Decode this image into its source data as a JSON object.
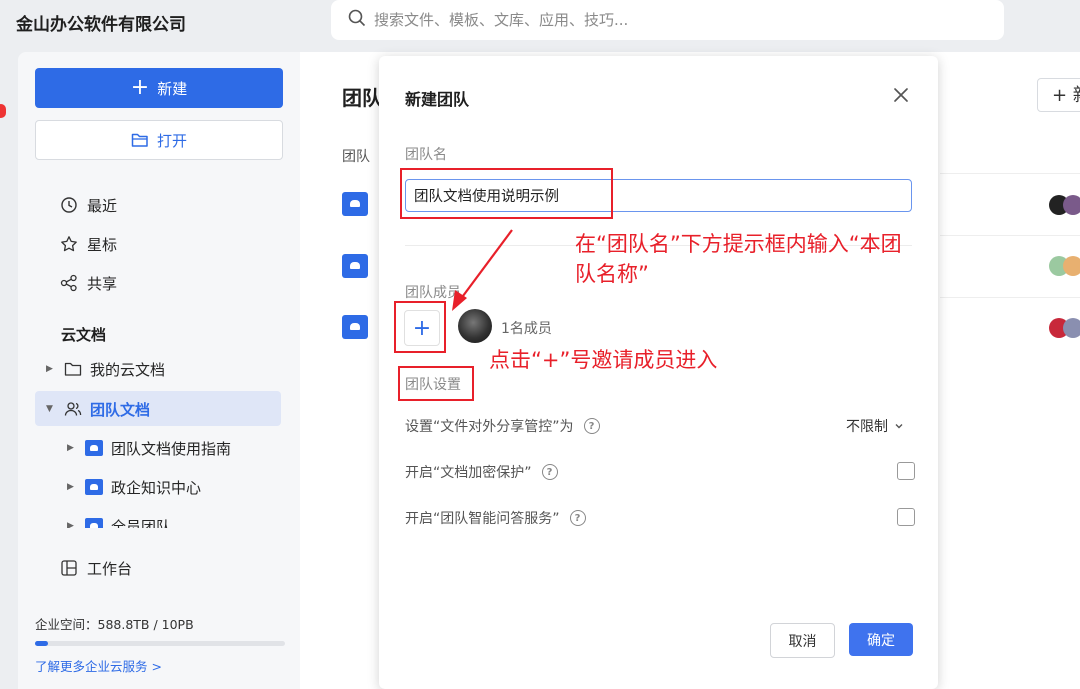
{
  "app": {
    "company": "金山办公软件有限公司",
    "search_placeholder": "搜索文件、模板、文库、应用、技巧..."
  },
  "sidebar": {
    "new_label": "新建",
    "open_label": "打开",
    "nav": [
      {
        "label": "最近",
        "icon": "clock-icon"
      },
      {
        "label": "星标",
        "icon": "star-icon"
      },
      {
        "label": "共享",
        "icon": "share-icon"
      }
    ],
    "section_title": "云文档",
    "tree": [
      {
        "label": "我的云文档"
      },
      {
        "label": "团队文档"
      },
      {
        "label": "团队文档使用指南"
      },
      {
        "label": "政企知识中心"
      },
      {
        "label": "全员团队"
      }
    ],
    "workbench_label": "工作台",
    "quota_text": "企业空间：588.8TB / 10PB",
    "quota_used_fraction": 0.05,
    "more_link": "了解更多企业云服务 >"
  },
  "main": {
    "title": "团队",
    "column": "团队",
    "new_partial": "+ 新"
  },
  "dialog": {
    "title": "新建团队",
    "name_label": "团队名",
    "name_value": "团队文档使用说明示例",
    "members_label": "团队成员",
    "add_symbol": "+",
    "member_count": "1名成员",
    "settings_label": "团队设置",
    "settings": [
      {
        "label": "设置“文件对外分享管控”为",
        "control": "select",
        "value": "不限制"
      },
      {
        "label": "开启“文档加密保护”",
        "control": "checkbox",
        "checked": false
      },
      {
        "label": "开启“团队智能问答服务”",
        "control": "checkbox",
        "checked": false
      }
    ],
    "cancel_label": "取消",
    "ok_label": "确定"
  },
  "annotations": {
    "name_hint": "在“团队名”下方提示框内输入“本团队名称”",
    "name_hint_line1": "在“团队名”下方提示框内输入“本团",
    "name_hint_line2": "队名称”",
    "member_hint": "点击“+”号邀请成员进入",
    "color": "#e8202a"
  },
  "colors": {
    "accent": "#2e6be6",
    "annotation_red": "#e8202a"
  }
}
